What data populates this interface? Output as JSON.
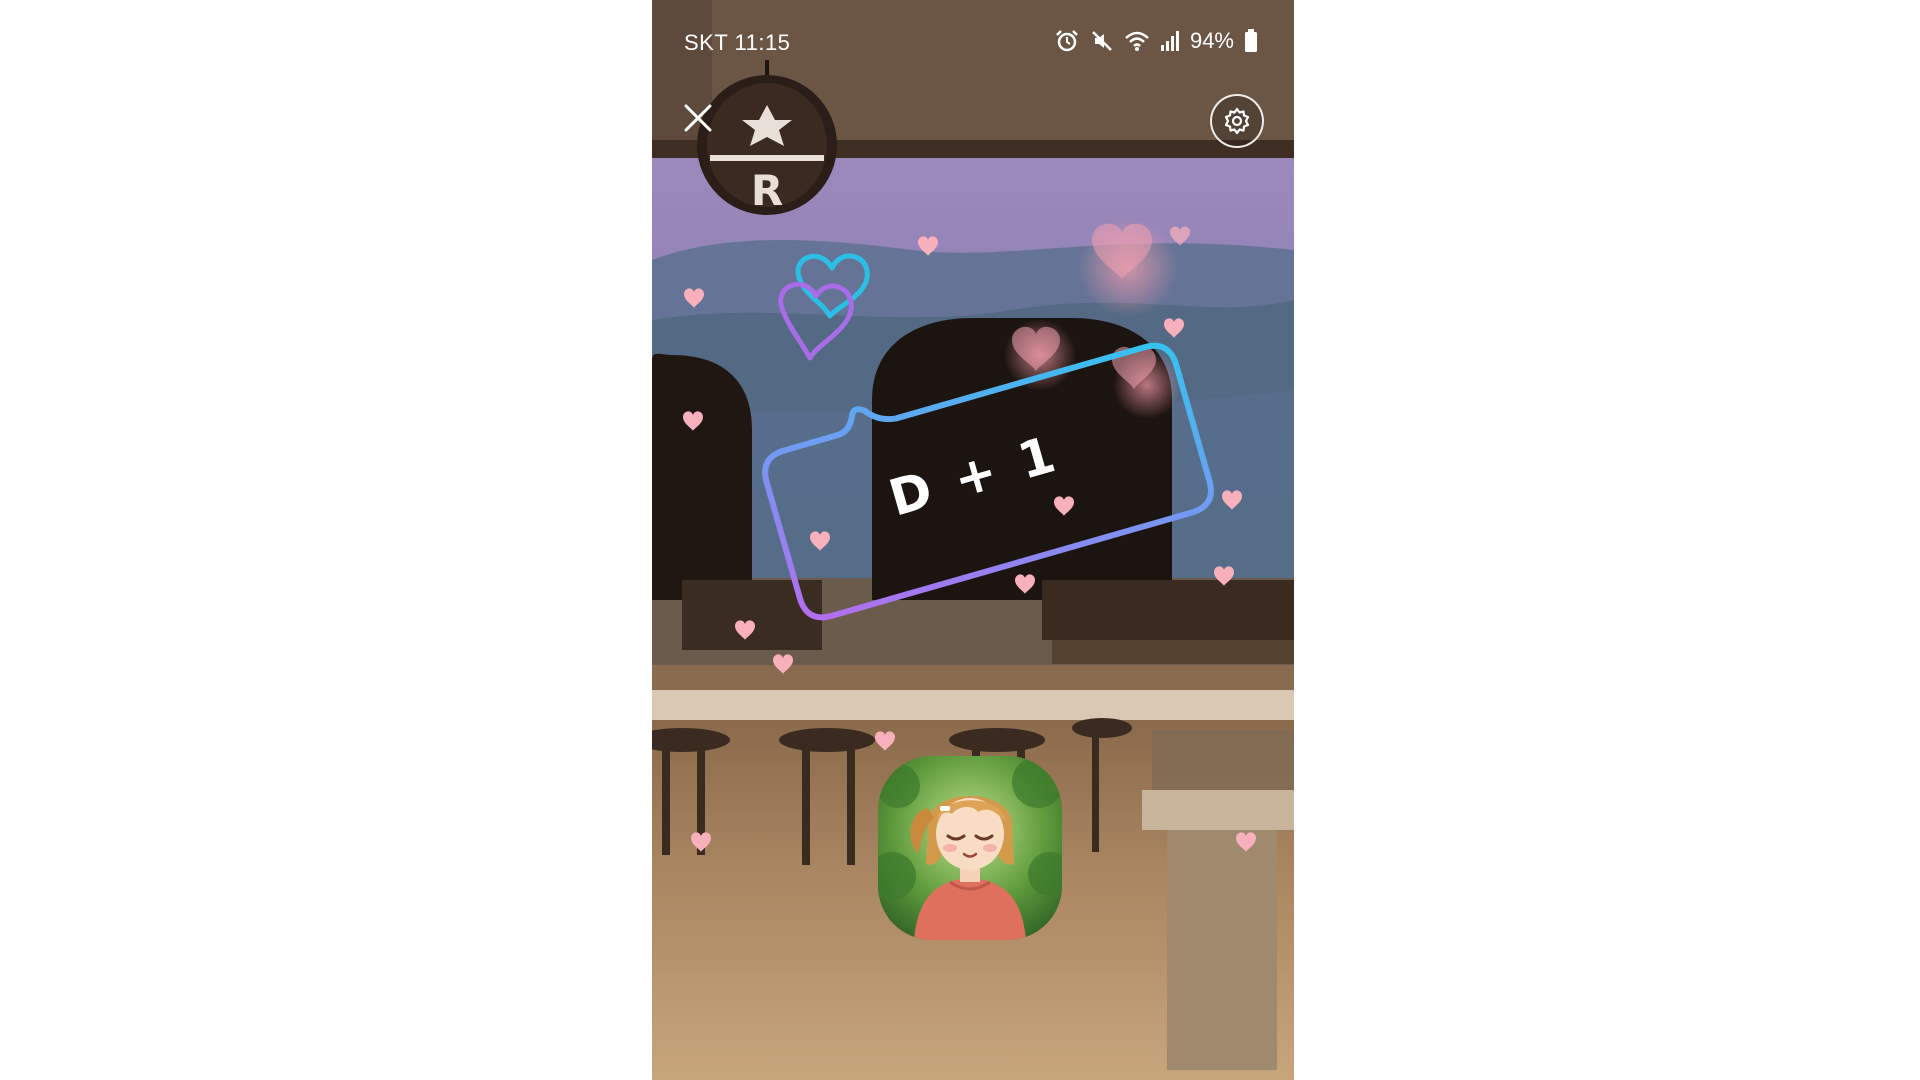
{
  "status_bar": {
    "carrier_time": "SKT 11:15",
    "battery": "94%",
    "icons": [
      "alarm-icon",
      "mute-icon",
      "wifi-icon",
      "signal-icon",
      "battery-icon"
    ]
  },
  "controls": {
    "close_icon": "close-icon",
    "settings_icon": "gear-icon"
  },
  "counter": {
    "label": "D + 1"
  },
  "avatar": {
    "description_icon": "character-avatar"
  },
  "colors": {
    "accent_gradient_start": "#b06cf0",
    "accent_gradient_end": "#2cc6ee",
    "heart_pink": "#f7a6b4"
  }
}
